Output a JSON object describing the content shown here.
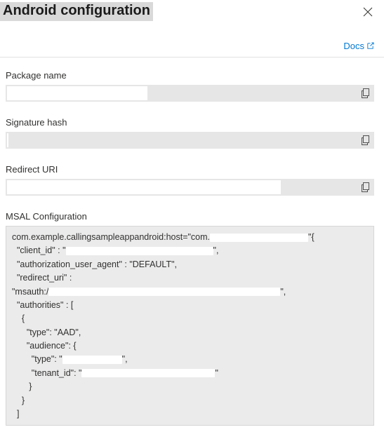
{
  "header": {
    "title": "Android configuration"
  },
  "docs": {
    "label": "Docs"
  },
  "fields": {
    "package_name": {
      "label": "Package name"
    },
    "signature_hash": {
      "label": "Signature hash"
    },
    "redirect_uri": {
      "label": "Redirect URI"
    },
    "msal_config": {
      "label": "MSAL Configuration"
    }
  },
  "msal": {
    "line1_pre": "com.example.callingsampleappandroid:host=\"com.",
    "line1_post": "\"{",
    "client_id_key": "  \"client_id\" : \"",
    "client_id_post": "\",",
    "auth_agent": "  \"authorization_user_agent\" : \"DEFAULT\",",
    "redirect_key": "  \"redirect_uri\" :",
    "msauth_pre": "\"msauth:/",
    "msauth_post": "\",",
    "authorities": "  \"authorities\" : [",
    "brace_open": "    {",
    "type_aad": "      \"type\": \"AAD\",",
    "audience_open": "      \"audience\": {",
    "aud_type_pre": "        \"type\": \"",
    "aud_type_post": "\",",
    "tenant_pre": "        \"tenant_id\": \"",
    "tenant_post": "\"",
    "brace_close_inner": "       }",
    "brace_close": "    }",
    "bracket_close": "  ]"
  }
}
